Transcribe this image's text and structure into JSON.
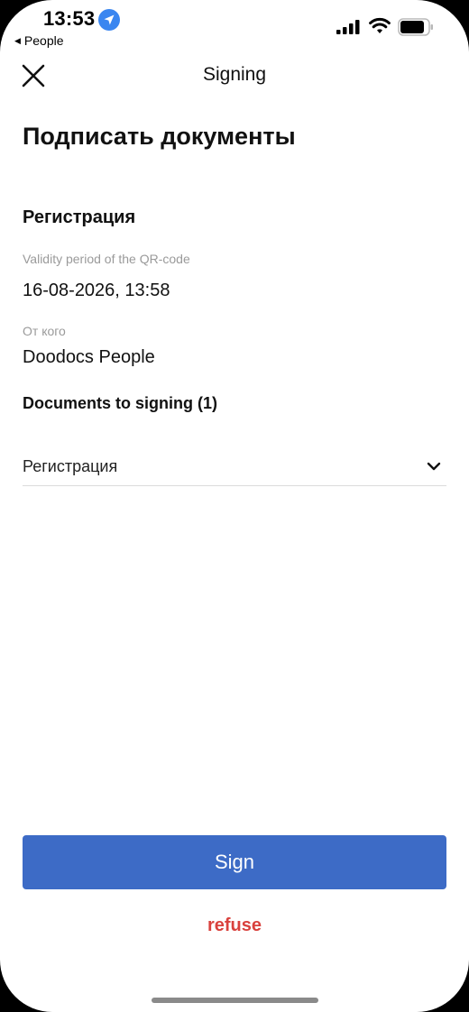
{
  "status_bar": {
    "time": "13:53",
    "back_app": "People",
    "location_icon": "location-arrow-icon",
    "signal_icon": "cellular-signal-icon",
    "wifi_icon": "wifi-icon",
    "battery_icon": "battery-icon"
  },
  "nav": {
    "title": "Signing",
    "close_icon": "close-icon"
  },
  "page_title": "Подписать документы",
  "section_title": "Регистрация",
  "fields": {
    "validity_label": "Validity period of the QR-code",
    "validity_value": "16-08-2026, 13:58",
    "from_label": "От кого",
    "from_value": "Doodocs People"
  },
  "documents": {
    "title": "Documents to signing (1)",
    "selected": "Регистрация",
    "chevron_icon": "chevron-down-icon"
  },
  "actions": {
    "sign_label": "Sign",
    "refuse_label": "refuse"
  },
  "colors": {
    "primary": "#3d6bc6",
    "danger": "#d9413d",
    "location_badge": "#3a86f0"
  }
}
